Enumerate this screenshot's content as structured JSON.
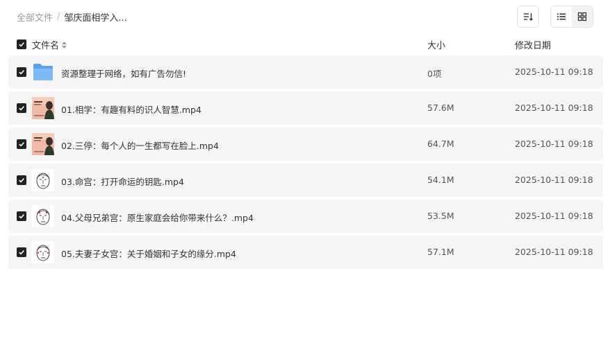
{
  "breadcrumb": {
    "root": "全部文件",
    "separator": "/",
    "current": "邹庆面相学入..."
  },
  "toolbar": {
    "sort_icon": "sort-icon",
    "list_view_icon": "list-view-icon",
    "grid_view_icon": "grid-view-icon",
    "active_view": "list"
  },
  "columns": {
    "name": "文件名",
    "size": "大小",
    "modified": "修改日期"
  },
  "files": [
    {
      "name": "资源整理于网络，如有广告勿信!",
      "size": "0项",
      "date": "2025-10-11 09:18",
      "type": "folder",
      "checked": true
    },
    {
      "name": "01.相学：有趣有料的识人智慧.mp4",
      "size": "57.6M",
      "date": "2025-10-11 09:18",
      "type": "video-cover",
      "checked": true
    },
    {
      "name": "02.三停：每个人的一生都写在脸上.mp4",
      "size": "64.7M",
      "date": "2025-10-11 09:18",
      "type": "video-cover",
      "checked": true
    },
    {
      "name": "03.命宫：打开命运的钥匙.mp4",
      "size": "54.1M",
      "date": "2025-10-11 09:18",
      "type": "video-sketch",
      "checked": true
    },
    {
      "name": "04.父母兄弟宫：原生家庭会给你带来什么？.mp4",
      "size": "53.5M",
      "date": "2025-10-11 09:18",
      "type": "video-sketch",
      "checked": true
    },
    {
      "name": "05.夫妻子女宫：关于婚姻和子女的缘分.mp4",
      "size": "57.1M",
      "date": "2025-10-11 09:18",
      "type": "video-sketch",
      "checked": true
    }
  ],
  "colors": {
    "row_bg": "#f5f5f6",
    "checkbox": "#222222",
    "folder": "#6aaef0",
    "muted_text": "#9a9a9a"
  }
}
